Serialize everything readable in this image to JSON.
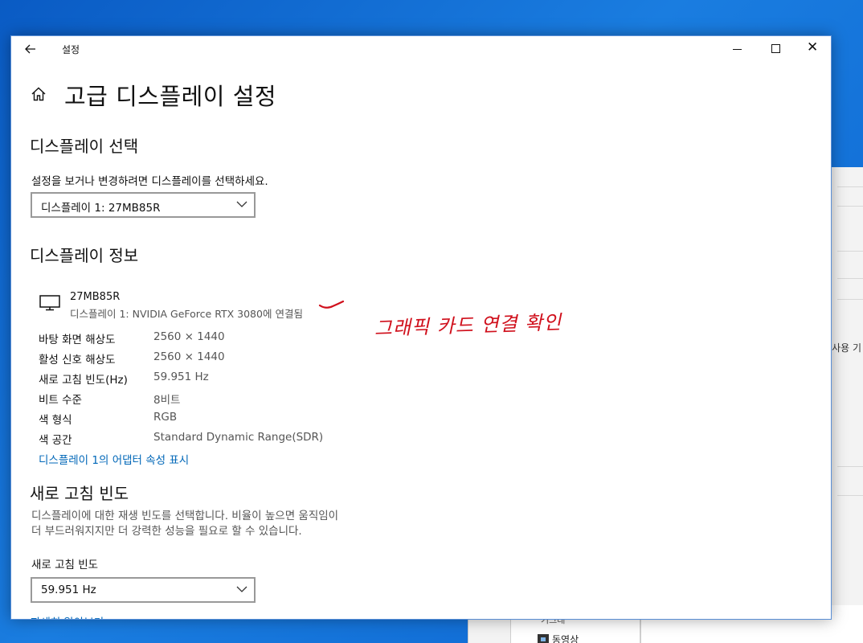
{
  "background_window": {
    "side_text": "사용 기",
    "item_cut": "기그래",
    "item_label": "동영상"
  },
  "window": {
    "app_title": "설정",
    "back_icon": "back-arrow-icon",
    "page_title": "고급 디스플레이 설정",
    "controls": [
      "minimize-icon",
      "maximize-icon",
      "close-icon"
    ]
  },
  "display_select": {
    "heading": "디스플레이 선택",
    "description": "설정을 보거나 변경하려면 디스플레이를 선택하세요.",
    "selected": "디스플레이 1: 27MB85R"
  },
  "display_info": {
    "heading": "디스플레이 정보",
    "monitor_name": "27MB85R",
    "monitor_connection": "디스플레이 1: NVIDIA GeForce RTX 3080에 연결됨",
    "rows": [
      {
        "label": "바탕 화면 해상도",
        "value": "2560 × 1440"
      },
      {
        "label": "활성 신호 해상도",
        "value": "2560 × 1440"
      },
      {
        "label": "새로 고침 빈도(Hz)",
        "value": "59.951 Hz"
      },
      {
        "label": "비트 수준",
        "value": "8비트"
      },
      {
        "label": "색 형식",
        "value": "RGB"
      },
      {
        "label": "색 공간",
        "value": "Standard Dynamic Range(SDR)"
      }
    ],
    "adapter_link": "디스플레이 1의 어댑터 속성 표시"
  },
  "refresh_rate": {
    "heading": "새로 고침 빈도",
    "description_line1": "디스플레이에 대한 재생 빈도를 선택합니다. 비율이 높으면 움직임이",
    "description_line2": "더 부드러워지지만 더 강력한 성능을 필요로 할 수 있습니다.",
    "label": "새로 고침 빈도",
    "selected": "59.951 Hz",
    "learn_more_link": "자세히 알아보기"
  },
  "annotation": {
    "text": "그래픽 카드 연결 확인",
    "color": "#d0101c"
  },
  "colors": {
    "accent_link": "#0067b8",
    "window_border": "#5a8fd6"
  }
}
